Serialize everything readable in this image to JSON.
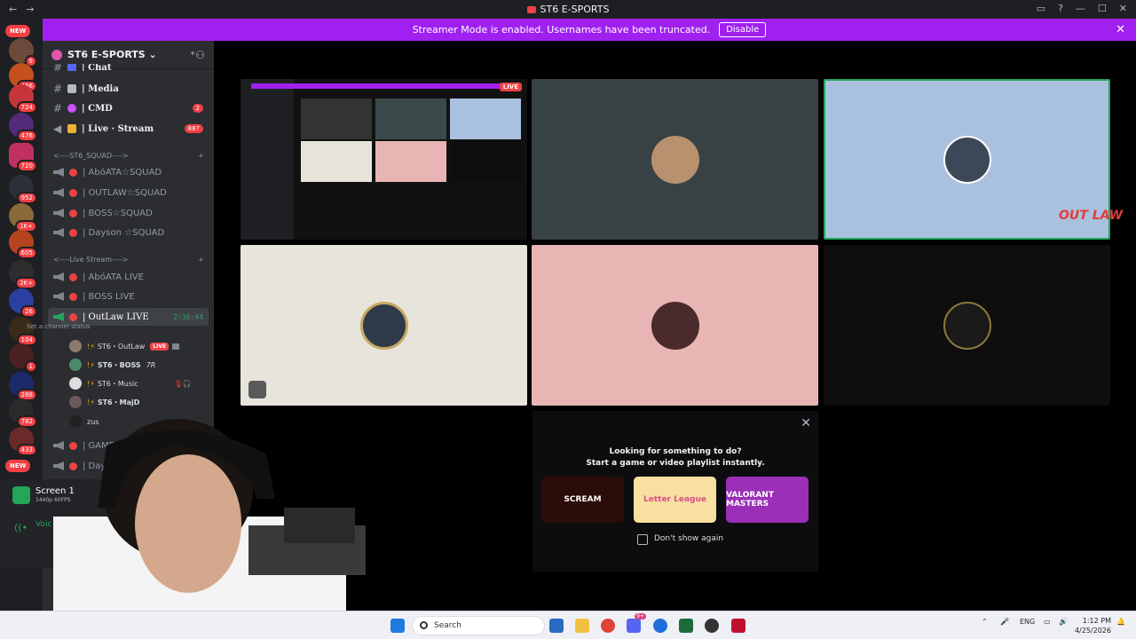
{
  "window": {
    "title": "ST6 E-SPORTS",
    "nav_back": "←",
    "nav_forward": "→"
  },
  "banner": {
    "message": "Streamer Mode is enabled. Usernames have been truncated.",
    "button": "Disable",
    "close": "✕"
  },
  "servers": {
    "new_label": "NEW",
    "new_label_bottom": "NEW",
    "counts": [
      "9",
      "456",
      "724",
      "476",
      "720",
      "952",
      "1K+",
      "605",
      "2K+",
      "26",
      "104",
      "1",
      "288",
      "782",
      "433"
    ]
  },
  "guild": {
    "name": "ST6 E-SPORTS ⌄",
    "add_member_icon": "add-member-icon"
  },
  "channels": {
    "partial_top": "| Chat",
    "text": [
      {
        "label": "| Media",
        "badge": ""
      },
      {
        "label": "| CMD",
        "badge": "2"
      },
      {
        "label": "| Live · Stream",
        "badge": "887"
      }
    ],
    "cat_squad": "<----ST6_SQUAD---->",
    "squad": [
      "| AbόATA☆SQUAD",
      "| OUTLAW☆SQUAD",
      "| BOSS☆SQUAD",
      "| Dayson ☆SQUAD"
    ],
    "cat_live": "<----Live Stream---->",
    "live": [
      "| AbόATA LIVE",
      "| BOSS LIVE"
    ],
    "active": {
      "label": "| OutLaw LIVE",
      "timer": "2:36:44",
      "status": "Set a channel status"
    },
    "users": [
      {
        "name": "ST6・OutLaw",
        "live": "LIVE"
      },
      {
        "name": "ST6・BOSS",
        "tag": "7R"
      },
      {
        "name": "ST6・Music"
      },
      {
        "name": "ST6・MajD"
      },
      {
        "name": "zus"
      }
    ],
    "after": [
      "| GAMEOVE",
      "| Dayso"
    ]
  },
  "user_panel": {
    "screen_title": "Screen 1",
    "screen_sub": "1440p 60FPS",
    "voice": "Voic"
  },
  "stage": {
    "live_tag": "LIVE",
    "outlaw_logo": "OUT LAW"
  },
  "popup": {
    "line1": "Looking for something to do?",
    "line2": "Start a game or video playlist instantly.",
    "cards": [
      "SCREAM",
      "Letter League",
      "VALORANT MASTERS"
    ],
    "dont_show": "Don't show again",
    "close": "✕"
  },
  "taskbar": {
    "search_placeholder": "Search",
    "lang": "ENG",
    "time": "1:12 PM",
    "date": "4/25/2026",
    "discord_badge": "9+"
  },
  "colors": {
    "accent": "#a020f0",
    "red": "#ed4245",
    "green": "#23a55a"
  }
}
